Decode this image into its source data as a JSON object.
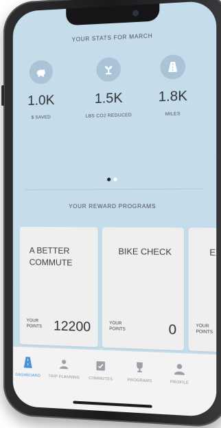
{
  "stats": {
    "title": "YOUR STATS FOR MARCH",
    "items": [
      {
        "icon": "piggy-bank-icon",
        "value": "1.0K",
        "label": "$ SAVED"
      },
      {
        "icon": "plant-icon",
        "value": "1.5K",
        "label": "LBS CO2 REDUCED"
      },
      {
        "icon": "road-icon",
        "value": "1.8K",
        "label": "MILES"
      }
    ]
  },
  "carousel": {
    "active_index": 0,
    "count": 2
  },
  "rewards": {
    "title": "YOUR REWARD PROGRAMS",
    "cards": [
      {
        "title": "A BETTER COMMUTE",
        "points_label": "YOUR POINTS",
        "points": "12200"
      },
      {
        "title": "BIKE CHECK",
        "points_label": "YOUR POINTS",
        "points": "0"
      },
      {
        "title": "EX",
        "points_label": "YOUR POINTS",
        "points": ""
      }
    ]
  },
  "tabs": [
    {
      "label": "DASHBOARD",
      "icon": "dashboard-icon",
      "active": true
    },
    {
      "label": "TRIP PLANNING",
      "icon": "trip-planning-icon",
      "active": false
    },
    {
      "label": "COMMUTES",
      "icon": "commutes-icon",
      "active": false
    },
    {
      "label": "PROGRAMS",
      "icon": "trophy-icon",
      "active": false
    },
    {
      "label": "PROFILE",
      "icon": "profile-icon",
      "active": false
    }
  ],
  "colors": {
    "screen_bg": "#c5dcea",
    "accent": "#4a90d9"
  }
}
